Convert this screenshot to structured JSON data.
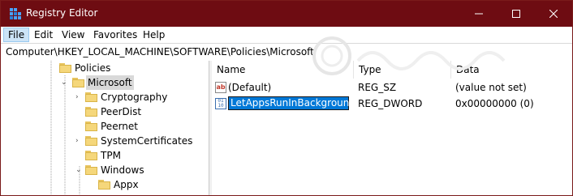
{
  "window": {
    "title": "Registry Editor"
  },
  "menu": [
    "File",
    "Edit",
    "View",
    "Favorites",
    "Help"
  ],
  "address_path": "Computer\\HKEY_LOCAL_MACHINE\\SOFTWARE\\Policies\\Microsoft",
  "tree": {
    "items": [
      {
        "label": "Policies",
        "expander": "none"
      },
      {
        "label": "Microsoft",
        "expander": "expanded",
        "selected": true
      },
      {
        "label": "Cryptography",
        "expander": "collapsed"
      },
      {
        "label": "PeerDist",
        "expander": "none"
      },
      {
        "label": "Peernet",
        "expander": "none"
      },
      {
        "label": "SystemCertificates",
        "expander": "collapsed"
      },
      {
        "label": "TPM",
        "expander": "none"
      },
      {
        "label": "Windows",
        "expander": "expanded"
      },
      {
        "label": "Appx",
        "expander": "none"
      }
    ]
  },
  "list": {
    "columns": [
      "Name",
      "Type",
      "Data"
    ],
    "rows": [
      {
        "name": "(Default)",
        "type": "REG_SZ",
        "data": "(value not set)",
        "icon": "string-value-icon"
      },
      {
        "name": "LetAppsRunInBackground.",
        "type": "REG_DWORD",
        "data": "0x00000000 (0)",
        "icon": "binary-value-icon",
        "editing": true
      }
    ]
  },
  "colors": {
    "titlebar": "#6e0c12",
    "selection": "#0078d7",
    "folder": "#f5d77b"
  }
}
